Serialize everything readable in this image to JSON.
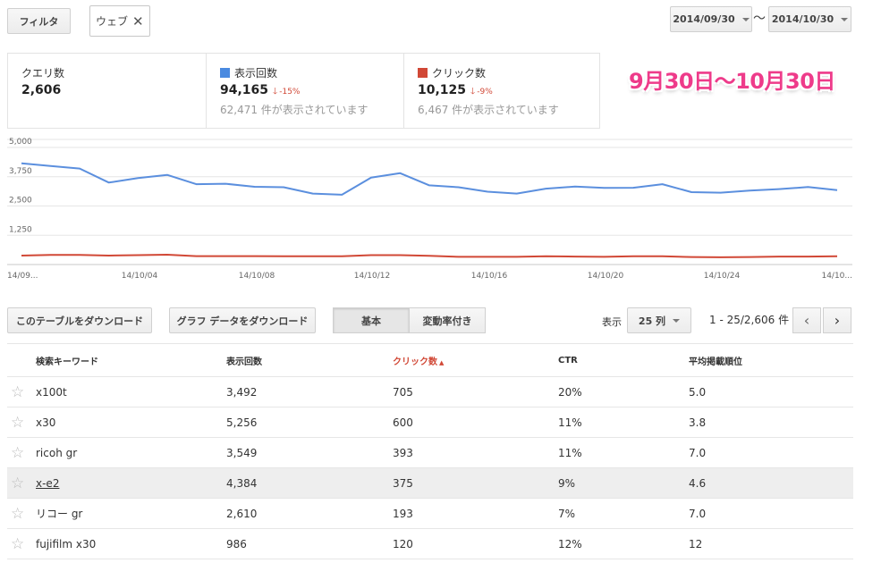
{
  "toolbar": {
    "filter_label": "フィルタ",
    "filter_chip": "ウェブ",
    "date_start": "2014/09/30",
    "date_end": "2014/10/30",
    "date_separator": "〜"
  },
  "summary": {
    "queries": {
      "label": "クエリ数",
      "value": "2,606"
    },
    "impressions": {
      "label": "表示回数",
      "value": "94,165",
      "change": "-15%",
      "sub": "62,471 件が表示されています",
      "color": "#4a8ae0"
    },
    "clicks": {
      "label": "クリック数",
      "value": "10,125",
      "change": "-9%",
      "sub": "6,467 件が表示されています",
      "color": "#d14836"
    }
  },
  "annotation": "9月30日〜10月30日",
  "chart_data": {
    "type": "line",
    "yticks": [
      "5,000",
      "3,750",
      "2,500",
      "1,250"
    ],
    "ylim": [
      0,
      5000
    ],
    "x_tick_labels": [
      "14/09...",
      "14/10/04",
      "14/10/08",
      "14/10/12",
      "14/10/16",
      "14/10/20",
      "14/10/24",
      "14/10..."
    ],
    "grid": true,
    "series": [
      {
        "name": "表示回数",
        "color": "#5b8fde",
        "values": [
          4320,
          4210,
          4100,
          3500,
          3690,
          3830,
          3430,
          3450,
          3320,
          3300,
          3030,
          2980,
          3710,
          3900,
          3380,
          3300,
          3110,
          3030,
          3240,
          3330,
          3270,
          3280,
          3430,
          3090,
          3070,
          3160,
          3220,
          3310,
          3180
        ]
      },
      {
        "name": "クリック数",
        "color": "#d14836",
        "values": [
          380,
          410,
          410,
          380,
          400,
          420,
          360,
          360,
          360,
          350,
          350,
          350,
          400,
          400,
          370,
          330,
          330,
          330,
          350,
          340,
          330,
          350,
          350,
          320,
          310,
          320,
          340,
          340,
          350
        ]
      }
    ]
  },
  "actions": {
    "download_table": "このテーブルをダウンロード",
    "download_chart": "グラフ データをダウンロード",
    "view_basic": "基本",
    "view_change": "変動率付き",
    "show_label": "表示",
    "rows_per_page": "25 列",
    "range": "1 - 25/2,606 件",
    "prev": "‹",
    "next": "›"
  },
  "table": {
    "headers": [
      "検索キーワード",
      "表示回数",
      "クリック数",
      "CTR",
      "平均掲載順位"
    ],
    "rows": [
      {
        "keyword": "x100t",
        "impressions": "3,492",
        "clicks": "705",
        "ctr": "20%",
        "position": "5.0"
      },
      {
        "keyword": "x30",
        "impressions": "5,256",
        "clicks": "600",
        "ctr": "11%",
        "position": "3.8"
      },
      {
        "keyword": "ricoh gr",
        "impressions": "3,549",
        "clicks": "393",
        "ctr": "11%",
        "position": "7.0"
      },
      {
        "keyword": "x-e2",
        "impressions": "4,384",
        "clicks": "375",
        "ctr": "9%",
        "position": "4.6"
      },
      {
        "keyword": "リコー gr",
        "impressions": "2,610",
        "clicks": "193",
        "ctr": "7%",
        "position": "7.0"
      },
      {
        "keyword": "fujifilm x30",
        "impressions": "986",
        "clicks": "120",
        "ctr": "12%",
        "position": "12"
      }
    ]
  }
}
